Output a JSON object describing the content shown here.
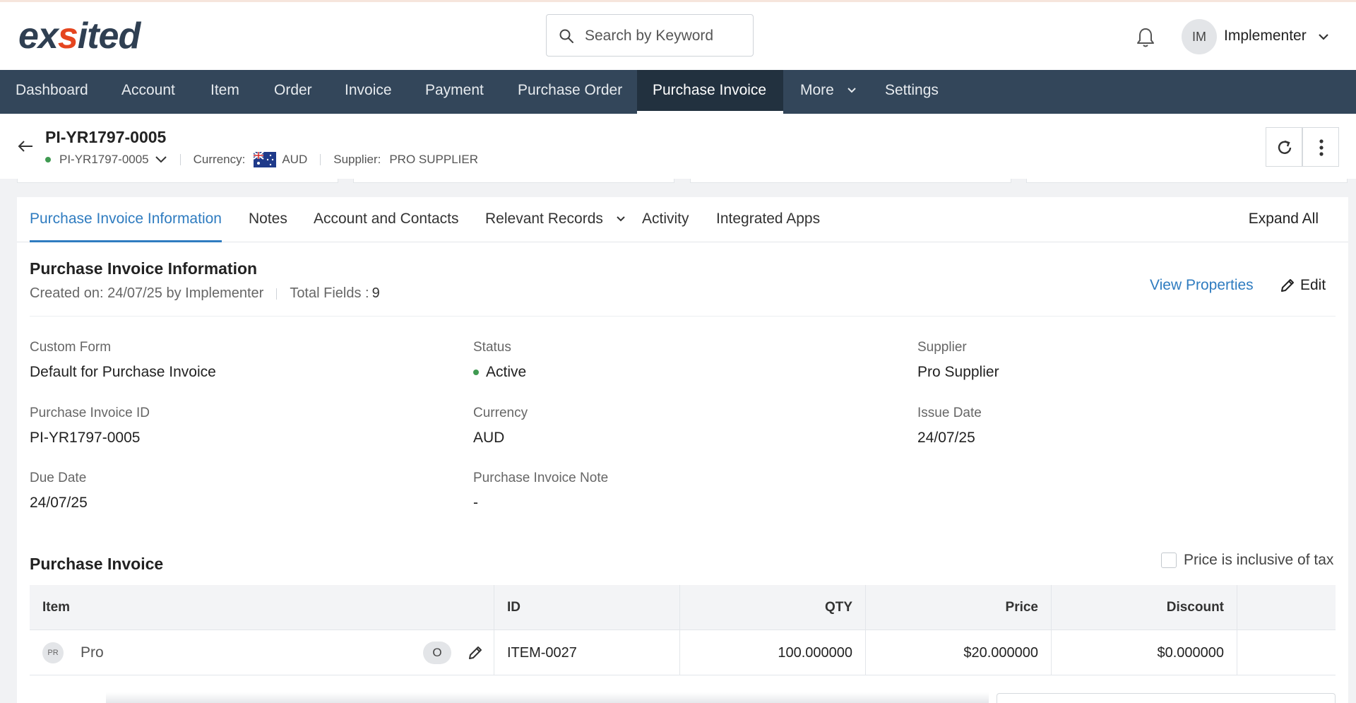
{
  "header": {
    "logo_text_a": "ex",
    "logo_text_b": "s",
    "logo_text_c": "ited",
    "search_placeholder": "Search by Keyword",
    "avatar_initials": "IM",
    "user_name": "Implementer"
  },
  "nav": {
    "items": [
      "Dashboard",
      "Account",
      "Item",
      "Order",
      "Invoice",
      "Payment",
      "Purchase Order",
      "Purchase Invoice",
      "More",
      "Settings"
    ],
    "active": "Purchase Invoice"
  },
  "record": {
    "title": "PI-YR1797-0005",
    "status_id": "PI-YR1797-0005",
    "currency_label": "Currency:",
    "currency_value": "AUD",
    "supplier_label": "Supplier:",
    "supplier_value": "PRO SUPPLIER"
  },
  "tabs": {
    "items": [
      "Purchase Invoice Information",
      "Notes",
      "Account and Contacts",
      "Relevant Records",
      "Activity",
      "Integrated Apps"
    ],
    "expand_all": "Expand All"
  },
  "section": {
    "title": "Purchase Invoice Information",
    "created": "Created on: 24/07/25 by Implementer",
    "total_fields_label": "Total Fields :",
    "total_fields_value": "9",
    "view_properties": "View Properties",
    "edit": "Edit"
  },
  "fields": [
    {
      "label": "Custom Form",
      "value": "Default for Purchase Invoice"
    },
    {
      "label": "Status",
      "value": "Active"
    },
    {
      "label": "Supplier",
      "value": "Pro Supplier"
    },
    {
      "label": "Purchase Invoice ID",
      "value": "PI-YR1797-0005"
    },
    {
      "label": "Currency",
      "value": "AUD"
    },
    {
      "label": "Issue Date",
      "value": "24/07/25"
    },
    {
      "label": "Due Date",
      "value": "24/07/25"
    },
    {
      "label": "Purchase Invoice Note",
      "value": "-"
    }
  ],
  "line_items": {
    "title": "Purchase Invoice",
    "tax_checkbox_label": "Price is inclusive of tax",
    "tax_checked": false,
    "columns": [
      "Item",
      "ID",
      "QTY",
      "Price",
      "Discount"
    ],
    "rows": [
      {
        "badge": "PR",
        "item": "Pro",
        "tag": "O",
        "id": "ITEM-0027",
        "qty": "100.000000",
        "price": "$20.000000",
        "discount": "$0.000000"
      }
    ]
  },
  "colors": {
    "nav_bg": "#33465a",
    "nav_active": "#22313f",
    "accent": "#2f7cc0",
    "status_active": "#3f9a51",
    "logo": "#2f3f52",
    "logo_accent": "#e5451f"
  }
}
